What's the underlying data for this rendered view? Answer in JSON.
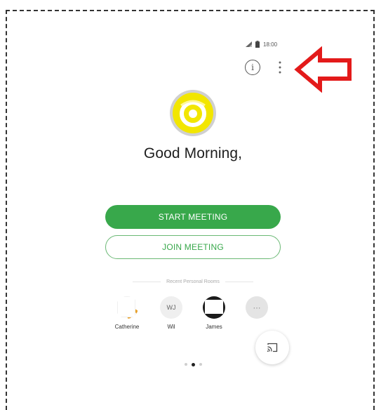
{
  "status_bar": {
    "time": "18:00",
    "icons": [
      "signal-icon",
      "battery-icon"
    ]
  },
  "header": {
    "info_icon": "info-icon",
    "info_glyph": "i",
    "more_icon": "more-vertical-icon"
  },
  "annotation": {
    "icon": "arrow-left-icon",
    "color": "#e31a1a"
  },
  "profile": {
    "avatar_icon": "avatar-icon",
    "avatar_color": "#f2e600",
    "greeting": "Good Morning,"
  },
  "actions": {
    "start_meeting": "START MEETING",
    "join_meeting": "JOIN MEETING",
    "accent": "#38a84b"
  },
  "recent_rooms": {
    "label": "Recent Personal Rooms",
    "items": [
      {
        "name": "Catherine",
        "initials": ""
      },
      {
        "name": "Wil",
        "initials": "WJ"
      },
      {
        "name": "James",
        "initials": ""
      },
      {
        "name": "",
        "initials": "⋯"
      }
    ]
  },
  "cast": {
    "icon": "cast-icon"
  },
  "pager": {
    "pages": 3,
    "current": 2
  }
}
